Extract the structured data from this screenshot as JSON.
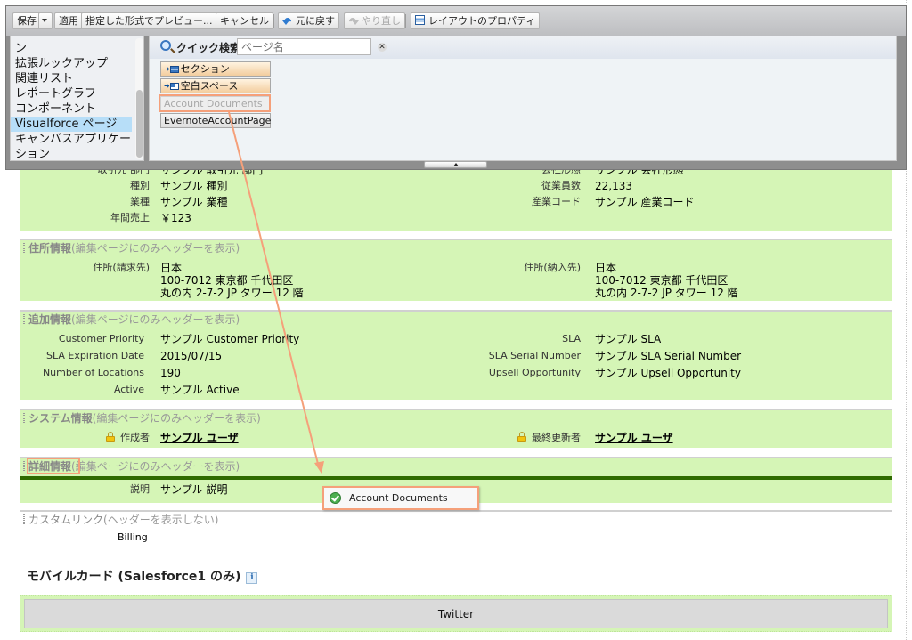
{
  "toolbar": {
    "save_label": "保存",
    "apply_label": "適用",
    "preview_label": "指定した形式でプレビュー...",
    "cancel_label": "キャンセル",
    "undo_label": "元に戻す",
    "redo_label": "やり直し",
    "layout_properties_label": "レイアウトのプロパティ"
  },
  "palette": {
    "categories": [
      {
        "label": "ン",
        "selected": false
      },
      {
        "label": "拡張ルックアップ",
        "selected": false
      },
      {
        "label": "関連リスト",
        "selected": false
      },
      {
        "label": "レポートグラフ",
        "selected": false
      },
      {
        "label": "コンポーネント",
        "selected": false
      },
      {
        "label": "Visualforce ページ",
        "selected": true
      },
      {
        "label": "キャンバスアプリケーション",
        "selected": false
      }
    ],
    "quick_search_label": "クイック検索",
    "quick_search_placeholder": "ページ名",
    "elements": [
      {
        "label": "セクション",
        "type": "section"
      },
      {
        "label": "空白スペース",
        "type": "blank-space"
      },
      {
        "label": "Account Documents",
        "type": "used"
      },
      {
        "label": "EvernoteAccountPage",
        "type": "page"
      }
    ]
  },
  "sections": {
    "account": {
      "hidden_row": {
        "left_label": "取引先 部門",
        "left_value": "サンプル 取引先 部門",
        "right_label": "会社形態",
        "right_value": "サンプル 会社形態"
      },
      "left": [
        {
          "label": "種別",
          "value": "サンプル 種別"
        },
        {
          "label": "業種",
          "value": "サンプル 業種"
        },
        {
          "label": "年間売上",
          "value": "￥123"
        }
      ],
      "right": [
        {
          "label": "従業員数",
          "value": "22,133"
        },
        {
          "label": "産業コード",
          "value": "サンプル 産業コード"
        }
      ]
    },
    "address": {
      "title": "住所情報",
      "subtitle": "(編集ページにのみヘッダーを表示)",
      "billing_label": "住所(請求先)",
      "billing_lines": [
        "日本",
        "100-7012 東京都 千代田区",
        "丸の内 2-7-2 JP タワー 12 階"
      ],
      "shipping_label": "住所(納入先)",
      "shipping_lines": [
        "日本",
        "100-7012 東京都 千代田区",
        "丸の内 2-7-2 JP タワー 12 階"
      ]
    },
    "additional": {
      "title": "追加情報",
      "subtitle": "(編集ページにのみヘッダーを表示)",
      "left": [
        {
          "label": "Customer Priority",
          "value": "サンプル Customer Priority"
        },
        {
          "label": "SLA Expiration Date",
          "value": "2015/07/15"
        },
        {
          "label": "Number of Locations",
          "value": "190"
        },
        {
          "label": "Active",
          "value": "サンプル Active"
        }
      ],
      "right": [
        {
          "label": "SLA",
          "value": "サンプル SLA"
        },
        {
          "label": "SLA Serial Number",
          "value": "サンプル SLA Serial Number"
        },
        {
          "label": "Upsell Opportunity",
          "value": "サンプル Upsell Opportunity"
        }
      ]
    },
    "system": {
      "title": "システム情報",
      "subtitle": "(編集ページにのみヘッダーを表示)",
      "created_by_label": "作成者",
      "created_by_value": "サンプル ユーザ",
      "modified_by_label": "最終更新者",
      "modified_by_value": "サンプル ユーザ"
    },
    "detail": {
      "title": "詳細情報",
      "subtitle": "(編集ページにのみヘッダーを表示)",
      "description_label": "説明",
      "description_value": "サンプル 説明"
    },
    "custom_links": {
      "title": "カスタムリンク",
      "subtitle": "(ヘッダーを表示しない)",
      "links": [
        "Billing"
      ]
    }
  },
  "drag_tooltip": "Account Documents",
  "mobile": {
    "title": "モバイルカード (Salesforce1 のみ)",
    "info_glyph": "i",
    "cards": [
      "Twitter"
    ]
  },
  "colors": {
    "section_bg": "#d5f5b6",
    "drop_indicator": "#2f6b00",
    "highlight": "#f5a07a",
    "selected_category": "#b7def8"
  }
}
